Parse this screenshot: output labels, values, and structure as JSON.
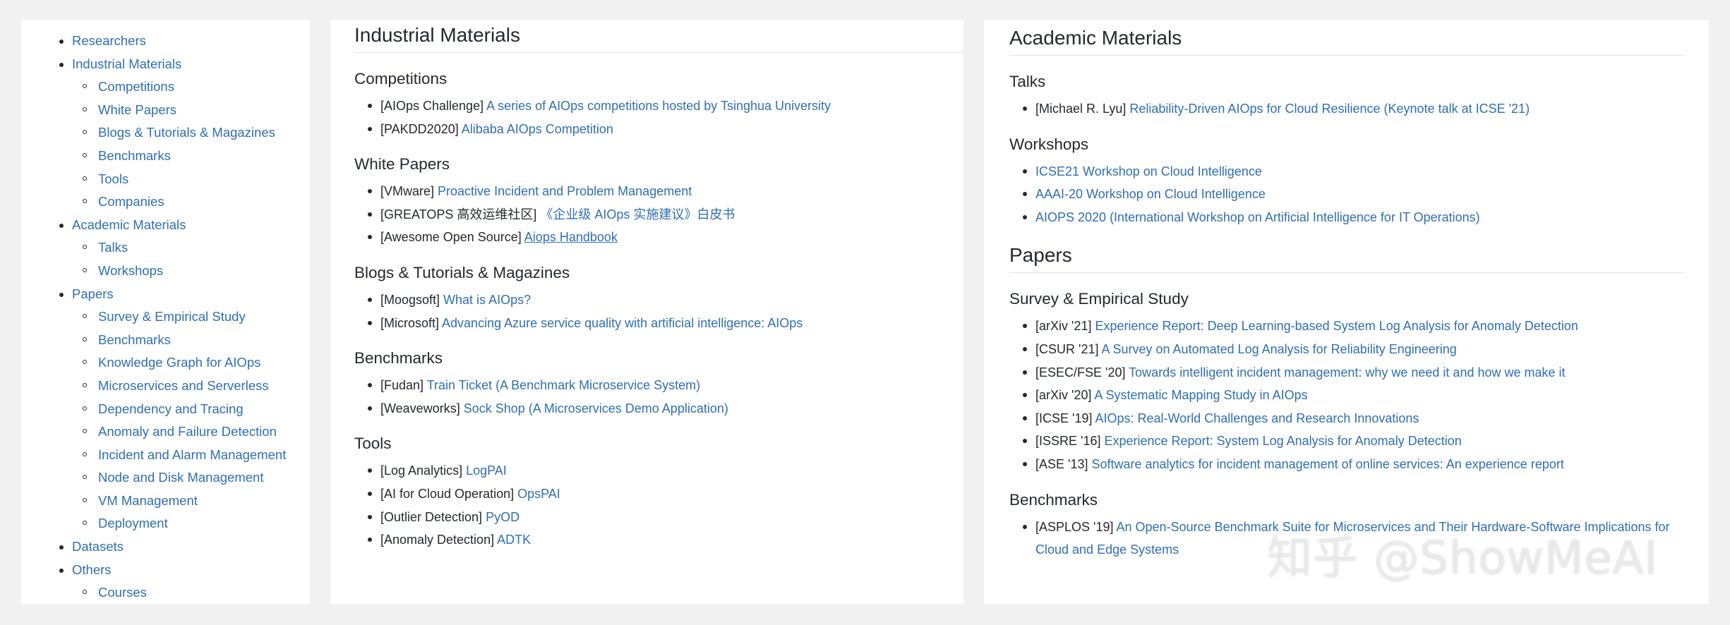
{
  "toc": {
    "items": [
      {
        "label": "Researchers",
        "children": []
      },
      {
        "label": "Industrial Materials",
        "children": [
          "Competitions",
          "White Papers",
          "Blogs & Tutorials & Magazines",
          "Benchmarks",
          "Tools",
          "Companies"
        ]
      },
      {
        "label": "Academic Materials",
        "children": [
          "Talks",
          "Workshops"
        ]
      },
      {
        "label": "Papers",
        "children": [
          "Survey & Empirical Study",
          "Benchmarks",
          "Knowledge Graph for AIOps",
          "Microservices and Serverless",
          "Dependency and Tracing",
          "Anomaly and Failure Detection",
          "Incident and Alarm Management",
          "Node and Disk Management",
          "VM Management",
          "Deployment"
        ]
      },
      {
        "label": "Datasets",
        "children": []
      },
      {
        "label": "Others",
        "children": [
          "Courses"
        ]
      }
    ]
  },
  "industrial": {
    "title": "Industrial Materials",
    "sections": [
      {
        "title": "Competitions",
        "items": [
          {
            "prefix": "[AIOps Challenge] ",
            "link": "A series of AIOps competitions hosted by Tsinghua University"
          },
          {
            "prefix": "[PAKDD2020] ",
            "link": "Alibaba AIOps Competition"
          }
        ]
      },
      {
        "title": "White Papers",
        "items": [
          {
            "prefix": "[VMware] ",
            "link": "Proactive Incident and Problem Management"
          },
          {
            "prefix": "[GREATOPS 高效运维社区] ",
            "link": "《企业级 AIOps 实施建议》白皮书"
          },
          {
            "prefix": "[Awesome Open Source] ",
            "link": "Aiops Handbook",
            "underline": true
          }
        ]
      },
      {
        "title": "Blogs & Tutorials & Magazines",
        "items": [
          {
            "prefix": "[Moogsoft] ",
            "link": "What is AIOps?"
          },
          {
            "prefix": "[Microsoft] ",
            "link": "Advancing Azure service quality with artificial intelligence: AIOps"
          }
        ]
      },
      {
        "title": "Benchmarks",
        "items": [
          {
            "prefix": "[Fudan] ",
            "link": "Train Ticket (A Benchmark Microservice System)"
          },
          {
            "prefix": "[Weaveworks] ",
            "link": "Sock Shop (A Microservices Demo Application)"
          }
        ]
      },
      {
        "title": "Tools",
        "items": [
          {
            "prefix": "[Log Analytics] ",
            "link": "LogPAI"
          },
          {
            "prefix": "[AI for Cloud Operation] ",
            "link": "OpsPAI"
          },
          {
            "prefix": "[Outlier Detection] ",
            "link": "PyOD"
          },
          {
            "prefix": "[Anomaly Detection] ",
            "link": "ADTK"
          }
        ]
      }
    ]
  },
  "academic": {
    "title": "Academic Materials",
    "sections": [
      {
        "title": "Talks",
        "items": [
          {
            "prefix": "[Michael R. Lyu] ",
            "link": "Reliability-Driven AIOps for Cloud Resilience (Keynote talk at ICSE '21)"
          }
        ]
      },
      {
        "title": "Workshops",
        "items": [
          {
            "prefix": "",
            "link": "ICSE21 Workshop on Cloud Intelligence"
          },
          {
            "prefix": "",
            "link": "AAAI-20 Workshop on Cloud Intelligence"
          },
          {
            "prefix": "",
            "link": "AIOPS 2020 (International Workshop on Artificial Intelligence for IT Operations)"
          }
        ]
      }
    ]
  },
  "papers": {
    "title": "Papers",
    "sections": [
      {
        "title": "Survey & Empirical Study",
        "items": [
          {
            "prefix": "[arXiv '21] ",
            "link": "Experience Report: Deep Learning-based System Log Analysis for Anomaly Detection"
          },
          {
            "prefix": "[CSUR '21] ",
            "link": "A Survey on Automated Log Analysis for Reliability Engineering"
          },
          {
            "prefix": "[ESEC/FSE '20] ",
            "link": "Towards intelligent incident management: why we need it and how we make it"
          },
          {
            "prefix": "[arXiv '20] ",
            "link": "A Systematic Mapping Study in AIOps"
          },
          {
            "prefix": "[ICSE '19] ",
            "link": "AIOps: Real-World Challenges and Research Innovations"
          },
          {
            "prefix": "[ISSRE '16] ",
            "link": "Experience Report: System Log Analysis for Anomaly Detection"
          },
          {
            "prefix": "[ASE '13] ",
            "link": "Software analytics for incident management of online services: An experience report"
          }
        ]
      },
      {
        "title": "Benchmarks",
        "items": [
          {
            "prefix": "[ASPLOS '19] ",
            "link": "An Open-Source Benchmark Suite for Microservices and Their Hardware-Software Implications for Cloud and Edge Systems"
          }
        ]
      }
    ]
  },
  "watermark": "知乎 @ShowMeAI"
}
